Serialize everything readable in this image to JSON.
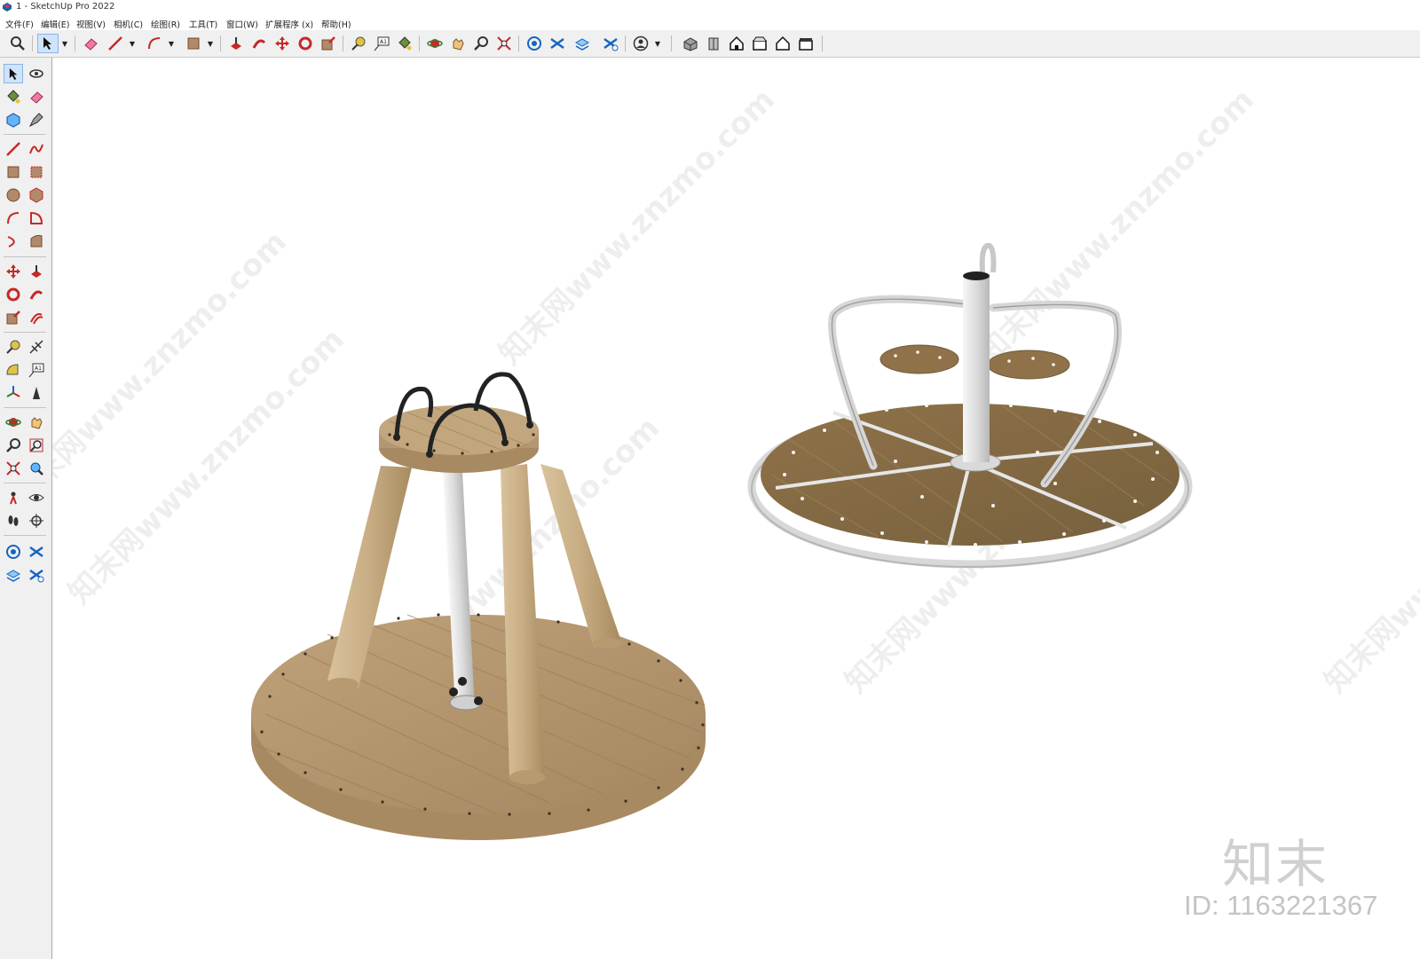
{
  "window": {
    "title": "1 - SketchUp Pro 2022"
  },
  "menu": [
    "文件(F)",
    "编辑(E)",
    "视图(V)",
    "相机(C)",
    "绘图(R)",
    "工具(T)",
    "窗口(W)",
    "扩展程序 (x)",
    "帮助(H)"
  ],
  "toolbar": {
    "icons": [
      "search-icon",
      "select-icon",
      "eraser-icon",
      "pencil-icon",
      "arc-icon",
      "rectangle-icon",
      "push-pull-icon",
      "follow-me-icon",
      "move-icon",
      "rotate-icon",
      "scale-icon",
      "tape-measure-icon",
      "text-icon",
      "paint-bucket-icon",
      "orbit-icon",
      "pan-icon",
      "zoom-icon",
      "zoom-extents-icon",
      "warehouse-icon",
      "extension-warehouse-icon",
      "layout-icon",
      "extension-manager-icon",
      "account-icon",
      "iso-view-icon",
      "front-view-icon",
      "top-view-icon",
      "right-view-icon",
      "back-view-icon",
      "left-view-icon"
    ]
  },
  "sidebar": {
    "icons": [
      "select-icon",
      "orbit-icon",
      "paint-bucket-icon",
      "eraser-icon",
      "component-icon",
      "tag-icon",
      "line-icon",
      "freehand-icon",
      "rectangle-icon",
      "rotated-rectangle-icon",
      "circle-icon",
      "polygon-icon",
      "arc-icon",
      "pie-icon",
      "two-point-arc-icon",
      "three-point-arc-icon",
      "move-icon",
      "push-pull-icon",
      "rotate-icon",
      "follow-me-icon",
      "scale-icon",
      "offset-icon",
      "tape-measure-icon",
      "dimension-icon",
      "protractor-icon",
      "text-icon",
      "axes-icon",
      "3d-text-icon",
      "orbit-icon",
      "pan-icon",
      "zoom-icon",
      "zoom-window-icon",
      "zoom-extents-icon",
      "previous-view-icon",
      "position-camera-icon",
      "look-around-icon",
      "walk-icon",
      "section-plane-icon",
      "warehouse-icon",
      "extension-warehouse-icon",
      "layout-icon",
      "extension-manager-icon"
    ]
  },
  "viewport": {
    "watermark_text": "知末网www.znzmo.com",
    "logo": "知末",
    "id_label": "ID: 1163221367"
  },
  "colors": {
    "wood_light": "#c9ad82",
    "wood_dark": "#a98a5c",
    "deck_brown": "#8a6e45",
    "metal": "#e6e6e6",
    "highlight": "#cfe3fb"
  }
}
